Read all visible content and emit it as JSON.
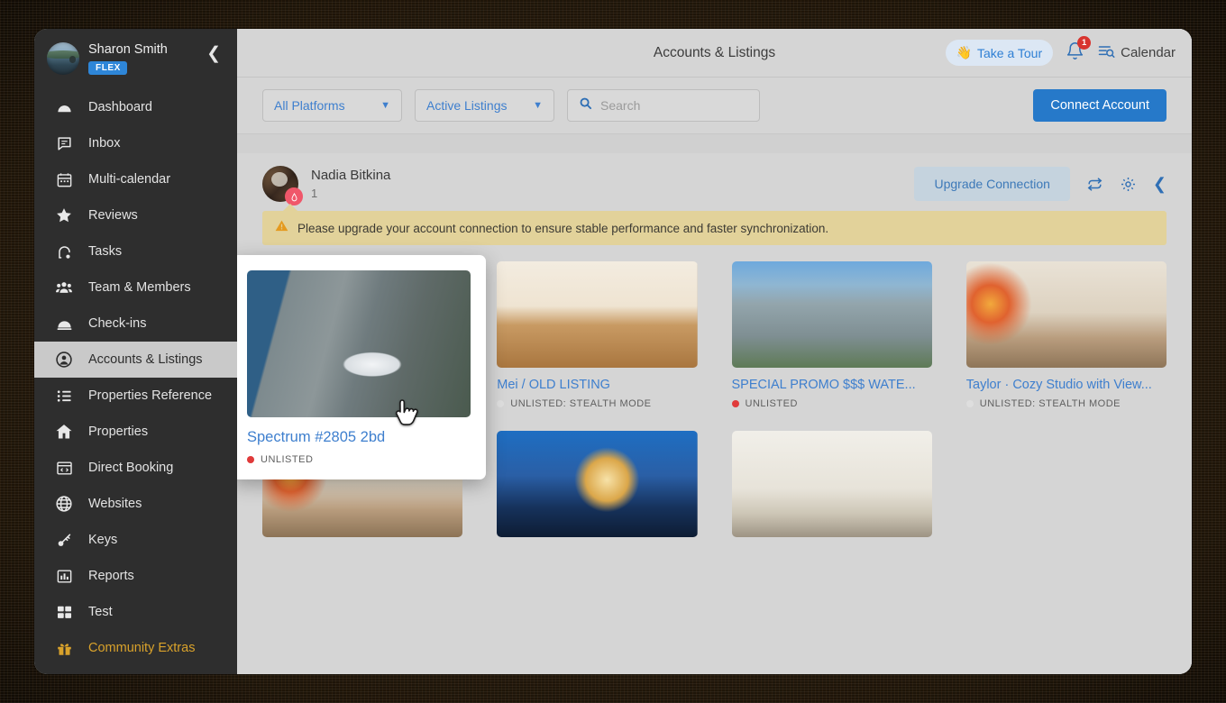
{
  "sidebar": {
    "user_name": "Sharon Smith",
    "plan_badge": "FLEX",
    "collapse_icon": "chevron-left-icon",
    "items": [
      {
        "label": "Dashboard",
        "icon": "dashboard-gauge-icon"
      },
      {
        "label": "Inbox",
        "icon": "chat-bubble-icon"
      },
      {
        "label": "Multi-calendar",
        "icon": "calendar-icon"
      },
      {
        "label": "Reviews",
        "icon": "star-icon"
      },
      {
        "label": "Tasks",
        "icon": "vacuum-icon"
      },
      {
        "label": "Team & Members",
        "icon": "people-group-icon"
      },
      {
        "label": "Check-ins",
        "icon": "bell-dome-icon"
      },
      {
        "label": "Accounts & Listings",
        "icon": "user-circle-icon"
      },
      {
        "label": "Properties Reference",
        "icon": "list-icon"
      },
      {
        "label": "Properties",
        "icon": "home-icon"
      },
      {
        "label": "Direct Booking",
        "icon": "code-window-icon"
      },
      {
        "label": "Websites",
        "icon": "globe-icon"
      },
      {
        "label": "Keys",
        "icon": "key-icon"
      },
      {
        "label": "Reports",
        "icon": "bar-chart-icon"
      },
      {
        "label": "Test",
        "icon": "grid-squares-icon"
      },
      {
        "label": "Community Extras",
        "icon": "gift-icon"
      }
    ],
    "active_index": 7,
    "accent_index": 15,
    "accent_color": "#d9a22b"
  },
  "topbar": {
    "title": "Accounts & Listings",
    "tour_label": "Take a Tour",
    "tour_icon": "waving-hand-icon",
    "bell_icon": "notification-bell-icon",
    "bell_count": "1",
    "calendar_label": "Calendar",
    "calendar_icon": "calendar-search-icon"
  },
  "filters": {
    "platform_select": "All Platforms",
    "status_select": "Active Listings",
    "search_placeholder": "Search",
    "search_value": "",
    "search_icon": "search-icon",
    "connect_label": "Connect Account",
    "connect_color": "#2679c9"
  },
  "account": {
    "name": "Nadia Bitkina",
    "listing_count": "1",
    "platform_badge": "airbnb-icon",
    "upgrade_label": "Upgrade Connection",
    "refresh_icon": "refresh-sync-icon",
    "settings_icon": "gear-icon",
    "collapse_icon": "chevron-left-icon",
    "warning_icon": "warning-triangle-icon",
    "warning_text": "Please upgrade your account connection to ensure stable performance and faster synchronization.",
    "warning_color": "#e2d29a"
  },
  "listings": [
    {
      "title": "Mei / OLD LISTING",
      "status": "UNLISTED: STEALTH MODE",
      "dot": "blank",
      "art": "t-dining"
    },
    {
      "title": "SPECIAL PROMO $$$ WATE...",
      "status": "UNLISTED",
      "dot": "red",
      "art": "t-highrise"
    },
    {
      "title": "Taylor · Cozy Studio with View...",
      "status": "UNLISTED: STEALTH MODE",
      "dot": "blank",
      "art": "t-livingroom"
    }
  ],
  "listings_row2": [
    {
      "art": "t-livingroom2"
    },
    {
      "art": "t-scienceworld"
    },
    {
      "art": "t-condo"
    }
  ],
  "hovercard": {
    "title": "Spectrum #2805 2bd",
    "status": "UNLISTED",
    "dot": "red",
    "art": "t-city-aerial",
    "cursor_icon": "pointing-hand-cursor"
  }
}
